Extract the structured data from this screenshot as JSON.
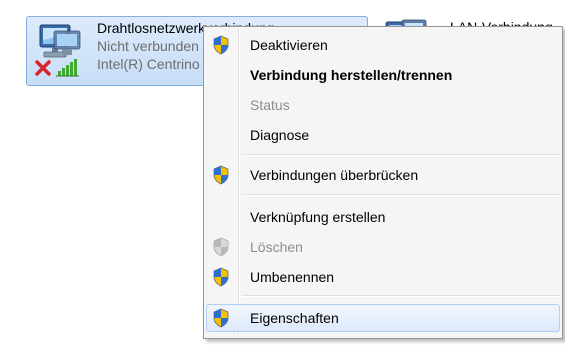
{
  "connections": [
    {
      "name": "Drahtlosnetzwerkverbindung",
      "status": "Nicht verbunden",
      "adapter": "Intel(R) Centrino",
      "icon": "wireless-network-icon"
    },
    {
      "name": "LAN-Verbindung",
      "icon": "lan-network-icon"
    }
  ],
  "context_menu": {
    "items": [
      {
        "label": "Deaktivieren",
        "icon": "uac-shield-icon",
        "bold": false,
        "disabled": false
      },
      {
        "label": "Verbindung herstellen/trennen",
        "bold": true,
        "disabled": false
      },
      {
        "label": "Status",
        "bold": false,
        "disabled": true
      },
      {
        "label": "Diagnose",
        "bold": false,
        "disabled": false
      },
      {
        "label": "Verbindungen überbrücken",
        "icon": "uac-shield-icon",
        "bold": false,
        "disabled": false
      },
      {
        "label": "Verknüpfung erstellen",
        "bold": false,
        "disabled": false
      },
      {
        "label": "Löschen",
        "icon": "uac-shield-icon",
        "bold": false,
        "disabled": true
      },
      {
        "label": "Umbenennen",
        "icon": "uac-shield-icon",
        "bold": false,
        "disabled": false
      },
      {
        "label": "Eigenschaften",
        "icon": "uac-shield-icon",
        "bold": false,
        "disabled": false,
        "highlighted": true
      }
    ]
  },
  "colors": {
    "selection_border": "#84acdd",
    "menu_background": "#f5f5f5",
    "disabled_text": "#8d8d8d",
    "secondary_text": "#6d6d6d"
  }
}
